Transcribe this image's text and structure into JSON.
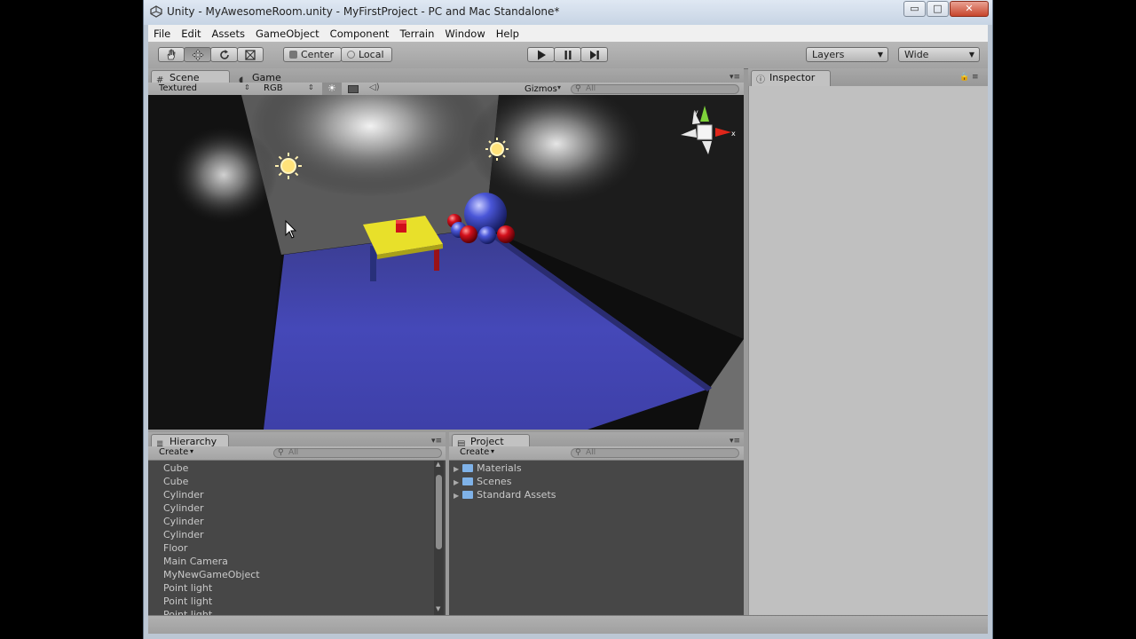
{
  "window": {
    "title": "Unity - MyAwesomeRoom.unity - MyFirstProject - PC and Mac Standalone*",
    "buttons": {
      "minimize": "▭",
      "maximize": "□",
      "close": "✕"
    }
  },
  "menu": [
    "File",
    "Edit",
    "Assets",
    "GameObject",
    "Component",
    "Terrain",
    "Window",
    "Help"
  ],
  "toolbar": {
    "center_label": "Center",
    "local_label": "Local",
    "layers_label": "Layers",
    "layout_label": "Wide"
  },
  "scene_panel": {
    "tabs": [
      "Scene",
      "Game"
    ],
    "render_mode": "Textured",
    "color_mode": "RGB",
    "gizmos_label": "Gizmos",
    "search_placeholder": "All"
  },
  "inspector": {
    "tab": "Inspector"
  },
  "hierarchy": {
    "tab": "Hierarchy",
    "create_label": "Create",
    "search_placeholder": "All",
    "items": [
      "Cube",
      "Cube",
      "Cylinder",
      "Cylinder",
      "Cylinder",
      "Cylinder",
      "Floor",
      "Main Camera",
      "MyNewGameObject",
      "Point light",
      "Point light",
      "Point light"
    ]
  },
  "project": {
    "tab": "Project",
    "create_label": "Create",
    "search_placeholder": "All",
    "folders": [
      "Materials",
      "Scenes",
      "Standard Assets"
    ]
  },
  "colors": {
    "floor": "#3c3fb4",
    "table": "#e8e02a",
    "red": "#d0101a",
    "sphere": "#3a48c8",
    "panel_dark": "#474747"
  },
  "icons": [
    "hand-icon",
    "move-icon",
    "rotate-icon",
    "scale-icon",
    "play-icon",
    "pause-icon",
    "step-icon",
    "light-icon",
    "lock-icon",
    "folder-icon"
  ]
}
